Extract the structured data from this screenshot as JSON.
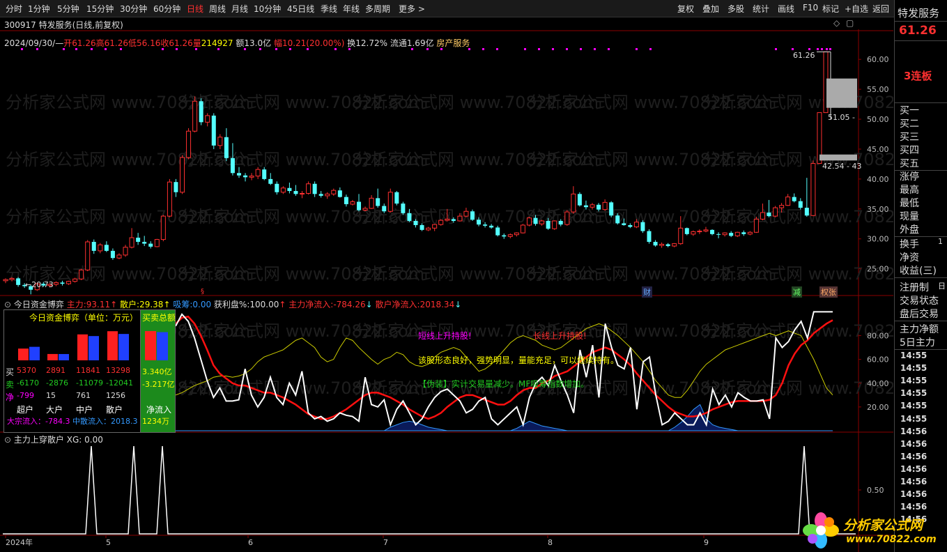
{
  "toolbar": {
    "items": [
      "分时",
      "1分钟",
      "5分钟",
      "15分钟",
      "30分钟",
      "60分钟",
      "日线",
      "周线",
      "月线",
      "10分钟",
      "45日线",
      "季线",
      "年线",
      "多周期",
      "更多 >"
    ],
    "active": "日线",
    "right_items": [
      "复权",
      "叠加",
      "多股",
      "统计",
      "画线",
      "F10",
      "标记",
      "+自选",
      "返回"
    ]
  },
  "stock": {
    "title": "300917 特发服务(日线,前复权)",
    "date": "2024/09/30/—",
    "open_label": "开",
    "open": "61.26",
    "high_label": "高",
    "high": "61.26",
    "low_label": "低",
    "low": "56.16",
    "close_label": "收",
    "close": "61.26",
    "vol_label": "量",
    "vol": "214927",
    "amount": "额13.0亿",
    "range_label": "幅",
    "range": "10.21(20.00%)",
    "turnover": "换12.72%",
    "float": "流通1.69亿",
    "sector": "房产服务"
  },
  "main_chart": {
    "y_ticks": [
      "60.00",
      "55.00",
      "50.00",
      "45.00",
      "40.00",
      "35.00",
      "30.00",
      "25.00"
    ],
    "y_tick_values": [
      60,
      55,
      50,
      45,
      40,
      35,
      30,
      25
    ],
    "ylim": [
      21,
      62
    ],
    "max_label": "61.26",
    "min_label": "←20.73",
    "bid_label_1": "51.05 -",
    "bid_label_2": "42.54 - 43",
    "marker_1": "财",
    "marker_2": "减",
    "marker_3": "权张",
    "candles": [
      [
        23.0,
        23.4,
        22.6,
        23.2
      ],
      [
        23.2,
        23.6,
        22.9,
        23.4
      ],
      [
        23.4,
        23.6,
        22.0,
        22.3
      ],
      [
        22.3,
        22.6,
        21.8,
        22.1
      ],
      [
        22.1,
        22.3,
        20.73,
        21.5
      ],
      [
        21.5,
        22.7,
        21.3,
        22.5
      ],
      [
        22.5,
        22.8,
        22.0,
        22.2
      ],
      [
        22.2,
        22.6,
        21.9,
        22.4
      ],
      [
        22.4,
        22.9,
        22.1,
        22.7
      ],
      [
        22.7,
        23.0,
        22.2,
        22.5
      ],
      [
        22.5,
        23.0,
        22.3,
        22.9
      ],
      [
        22.9,
        23.5,
        22.7,
        23.3
      ],
      [
        23.3,
        25.0,
        23.1,
        24.8
      ],
      [
        24.8,
        29.8,
        24.6,
        29.5
      ],
      [
        29.5,
        29.9,
        27.5,
        28.0
      ],
      [
        28.0,
        29.3,
        27.6,
        29.0
      ],
      [
        29.0,
        29.6,
        27.8,
        28.0
      ],
      [
        28.0,
        28.4,
        26.5,
        26.8
      ],
      [
        26.8,
        27.6,
        26.6,
        27.3
      ],
      [
        27.3,
        29.0,
        27.0,
        28.6
      ],
      [
        28.6,
        31.8,
        28.4,
        30.2
      ],
      [
        30.2,
        31.0,
        29.0,
        29.5
      ],
      [
        29.5,
        30.5,
        28.8,
        29.2
      ],
      [
        29.2,
        29.6,
        28.4,
        28.7
      ],
      [
        28.7,
        30.0,
        28.6,
        29.9
      ],
      [
        29.9,
        34.0,
        29.6,
        33.8
      ],
      [
        33.8,
        40.0,
        33.6,
        39.5
      ],
      [
        39.5,
        40.0,
        37.0,
        37.8
      ],
      [
        37.8,
        44.0,
        37.5,
        43.6
      ],
      [
        43.6,
        48.5,
        43.3,
        48.0
      ],
      [
        48.0,
        53.8,
        47.8,
        53.0
      ],
      [
        53.0,
        53.5,
        49.0,
        49.5
      ],
      [
        49.5,
        51.0,
        48.8,
        50.6
      ],
      [
        50.6,
        51.0,
        45.0,
        45.6
      ],
      [
        45.6,
        47.5,
        45.0,
        47.0
      ],
      [
        47.0,
        48.5,
        43.0,
        43.5
      ],
      [
        43.5,
        46.0,
        40.6,
        41.0
      ],
      [
        41.0,
        42.0,
        40.2,
        40.6
      ],
      [
        40.6,
        41.0,
        39.6,
        40.3
      ],
      [
        40.3,
        41.0,
        39.8,
        40.5
      ],
      [
        40.5,
        42.0,
        40.0,
        41.6
      ],
      [
        41.6,
        42.0,
        39.8,
        40.0
      ],
      [
        40.0,
        41.0,
        39.0,
        39.2
      ],
      [
        39.2,
        39.6,
        37.4,
        37.8
      ],
      [
        37.8,
        38.8,
        37.5,
        38.5
      ],
      [
        38.5,
        39.4,
        37.6,
        38.0
      ],
      [
        38.0,
        39.0,
        37.2,
        37.5
      ],
      [
        37.5,
        38.0,
        36.8,
        37.6
      ],
      [
        37.6,
        39.6,
        37.4,
        39.2
      ],
      [
        39.2,
        39.6,
        37.0,
        37.5
      ],
      [
        37.5,
        38.0,
        36.9,
        37.2
      ],
      [
        37.2,
        37.8,
        36.7,
        37.5
      ],
      [
        37.5,
        38.4,
        37.2,
        38.1
      ],
      [
        38.1,
        38.6,
        36.9,
        37.0
      ],
      [
        37.0,
        37.4,
        35.4,
        35.8
      ],
      [
        35.8,
        36.5,
        35.6,
        36.2
      ],
      [
        36.2,
        37.5,
        34.6,
        34.8
      ],
      [
        34.8,
        35.4,
        34.6,
        35.1
      ],
      [
        35.1,
        37.3,
        35.0,
        36.8
      ],
      [
        36.8,
        38.4,
        35.2,
        35.5
      ],
      [
        35.5,
        35.9,
        34.3,
        34.6
      ],
      [
        34.6,
        38.4,
        34.4,
        37.8
      ],
      [
        37.8,
        38.0,
        35.6,
        35.9
      ],
      [
        35.9,
        36.2,
        34.0,
        34.3
      ],
      [
        34.3,
        35.0,
        32.8,
        33.0
      ],
      [
        33.0,
        33.3,
        31.9,
        32.3
      ],
      [
        32.3,
        32.6,
        31.3,
        31.5
      ],
      [
        31.5,
        32.0,
        31.3,
        31.8
      ],
      [
        31.8,
        32.5,
        31.3,
        32.4
      ],
      [
        32.4,
        33.3,
        32.2,
        33.1
      ],
      [
        33.1,
        35.0,
        32.9,
        33.3
      ],
      [
        33.3,
        33.6,
        32.7,
        33.0
      ],
      [
        33.0,
        34.3,
        32.9,
        33.8
      ],
      [
        33.8,
        35.2,
        33.6,
        34.6
      ],
      [
        34.6,
        34.9,
        33.0,
        33.2
      ],
      [
        33.2,
        33.6,
        32.1,
        32.4
      ],
      [
        32.4,
        32.8,
        31.9,
        32.2
      ],
      [
        32.2,
        32.5,
        31.7,
        31.9
      ],
      [
        31.9,
        32.2,
        30.4,
        30.6
      ],
      [
        30.6,
        30.9,
        30.0,
        30.4
      ],
      [
        30.4,
        30.9,
        30.1,
        30.7
      ],
      [
        30.7,
        31.1,
        30.4,
        31.0
      ],
      [
        31.0,
        32.5,
        30.9,
        32.3
      ],
      [
        32.3,
        33.7,
        32.1,
        33.5
      ],
      [
        33.5,
        34.0,
        32.2,
        32.5
      ],
      [
        32.5,
        33.2,
        32.2,
        33.0
      ],
      [
        33.0,
        33.5,
        31.5,
        31.7
      ],
      [
        31.7,
        33.1,
        31.5,
        33.0
      ],
      [
        33.0,
        33.3,
        32.1,
        32.4
      ],
      [
        32.4,
        34.8,
        32.2,
        34.5
      ],
      [
        34.5,
        38.8,
        34.2,
        37.5
      ],
      [
        37.5,
        37.8,
        35.4,
        35.6
      ],
      [
        35.6,
        36.4,
        34.9,
        35.3
      ],
      [
        35.3,
        36.0,
        34.9,
        35.7
      ],
      [
        35.7,
        36.0,
        34.6,
        34.9
      ],
      [
        34.9,
        36.6,
        34.7,
        36.1
      ],
      [
        36.1,
        36.3,
        33.6,
        33.9
      ],
      [
        33.9,
        34.3,
        32.4,
        32.6
      ],
      [
        32.6,
        33.4,
        32.2,
        32.3
      ],
      [
        32.3,
        32.6,
        31.8,
        32.0
      ],
      [
        32.0,
        33.3,
        31.8,
        32.8
      ],
      [
        32.8,
        33.1,
        31.0,
        31.3
      ],
      [
        31.3,
        31.6,
        29.2,
        29.5
      ],
      [
        29.5,
        29.8,
        28.7,
        28.9
      ],
      [
        28.9,
        29.4,
        28.5,
        29.1
      ],
      [
        29.1,
        29.3,
        28.6,
        28.8
      ],
      [
        28.8,
        29.3,
        28.6,
        29.2
      ],
      [
        29.2,
        33.8,
        29.0,
        31.8
      ],
      [
        31.8,
        31.9,
        30.6,
        30.8
      ],
      [
        30.8,
        31.4,
        30.5,
        31.2
      ],
      [
        31.2,
        31.6,
        30.8,
        31.3
      ],
      [
        31.3,
        32.0,
        31.1,
        31.5
      ],
      [
        31.5,
        31.6,
        30.6,
        30.8
      ],
      [
        30.8,
        31.1,
        30.1,
        30.7
      ],
      [
        30.7,
        31.1,
        30.4,
        31.0
      ],
      [
        31.0,
        31.3,
        30.3,
        30.5
      ],
      [
        30.5,
        31.2,
        30.3,
        31.1
      ],
      [
        31.1,
        31.4,
        30.5,
        30.8
      ],
      [
        30.8,
        31.3,
        30.6,
        31.1
      ],
      [
        31.1,
        33.7,
        31.0,
        33.3
      ],
      [
        33.3,
        35.9,
        33.1,
        34.4
      ],
      [
        34.4,
        36.5,
        33.6,
        33.8
      ],
      [
        33.8,
        35.5,
        33.6,
        35.2
      ],
      [
        35.2,
        36.0,
        34.4,
        35.6
      ],
      [
        35.6,
        37.5,
        35.5,
        37.0
      ],
      [
        37.0,
        37.6,
        36.1,
        36.3
      ],
      [
        36.3,
        36.8,
        34.9,
        35.2
      ],
      [
        35.2,
        40.2,
        33.7,
        33.9
      ],
      [
        33.9,
        43.1,
        33.8,
        42.6
      ],
      [
        42.6,
        51.1,
        42.5,
        51.1
      ],
      [
        51.1,
        61.26,
        56.16,
        61.26
      ]
    ]
  },
  "indicator1": {
    "name": "今日资金博弈",
    "zhuli_label": "主力:",
    "zhuli_val": "93.11",
    "sanhu_label": "散户:",
    "sanhu_val": "29.38",
    "xichou_label": "吸筹:",
    "xichou_val": "0.00",
    "huoli_label": "获利盘%:",
    "huoli_val": "100.00",
    "zhuli_net_label": "主力净流入:",
    "zhuli_net_val": "-784.26",
    "sanhu_net_label": "散户净流入:",
    "sanhu_net_val": "2018.34",
    "y_ticks": [
      "80.00",
      "60.00",
      "40.00",
      "20.00"
    ],
    "y_tick_values": [
      80,
      60,
      40,
      20
    ],
    "ylim": [
      0,
      102
    ],
    "text_1": "短线上升持股!",
    "text_2": "长线上升持股!",
    "text_3": "该股形态良好，强势明显，量能充足，可以继续持有。",
    "text_4": "【伪装】实计交易量减少。MF吸筹指数增加。",
    "white": [
      88,
      98,
      92,
      78,
      60,
      42,
      28,
      36,
      25,
      25,
      26,
      52,
      30,
      20,
      28,
      45,
      28,
      22,
      40,
      30,
      50,
      15,
      10,
      12,
      8,
      10,
      15,
      13,
      12,
      8,
      45,
      22,
      20,
      26,
      5,
      18,
      25,
      15,
      5,
      10,
      20,
      28,
      33,
      35,
      30,
      25,
      15,
      18,
      25,
      28,
      10,
      5,
      10,
      15,
      20,
      5,
      28,
      40,
      45,
      38,
      55,
      42,
      30,
      15,
      68,
      45,
      72,
      28,
      90,
      70,
      55,
      52,
      70,
      18,
      58,
      62,
      30,
      5,
      8,
      15,
      10,
      5,
      5,
      15,
      5,
      35,
      22,
      30,
      20,
      32,
      28,
      25,
      25,
      26,
      10,
      78,
      70,
      75,
      85,
      92,
      78,
      100,
      100,
      100,
      100
    ],
    "red": [
      90,
      95,
      96,
      90,
      80,
      68,
      55,
      48,
      44,
      40,
      38,
      38,
      36,
      34,
      32,
      32,
      30,
      28,
      25,
      22,
      18,
      14,
      12,
      10,
      10,
      12,
      15,
      18,
      22,
      26,
      30,
      32,
      32,
      30,
      28,
      25,
      22,
      18,
      15,
      12,
      10,
      12,
      15,
      20,
      24,
      28,
      30,
      30,
      28,
      26,
      24,
      22,
      22,
      25,
      30,
      34,
      36,
      36,
      40,
      42,
      46,
      48,
      50,
      54,
      58,
      62,
      66,
      68,
      70,
      68,
      64,
      60,
      55,
      48,
      42,
      36,
      30,
      25,
      20,
      16,
      14,
      12,
      12,
      13,
      15,
      18,
      20,
      22,
      24,
      25,
      25,
      25,
      25,
      25,
      26,
      30,
      40,
      55,
      65,
      72,
      76,
      82,
      86,
      90,
      93
    ],
    "yellow": [
      30,
      32,
      35,
      38,
      40,
      42,
      45,
      46,
      46,
      45,
      46,
      48,
      52,
      58,
      62,
      64,
      66,
      68,
      72,
      76,
      78,
      74,
      70,
      62,
      58,
      60,
      70,
      78,
      76,
      70,
      65,
      60,
      56,
      60,
      62,
      66,
      64,
      58,
      55,
      54,
      56,
      62,
      66,
      68,
      70,
      68,
      62,
      56,
      50,
      52,
      56,
      62,
      68,
      74,
      78,
      80,
      78,
      76,
      72,
      70,
      68,
      70,
      74,
      78,
      82,
      86,
      88,
      90,
      88,
      84,
      80,
      75,
      70,
      64,
      58,
      50,
      42,
      36,
      30,
      28,
      28,
      34,
      42,
      50,
      56,
      60,
      64,
      68,
      70,
      72,
      74,
      76,
      78,
      80,
      82,
      80,
      82,
      84,
      82,
      80,
      70,
      60,
      48,
      36,
      30
    ],
    "blue": [
      0,
      0,
      0,
      0,
      0,
      0,
      0,
      0,
      0,
      0,
      0,
      0,
      0,
      0,
      0,
      0,
      0,
      0,
      0,
      0,
      0,
      0,
      0,
      0,
      0,
      0,
      0,
      0,
      0,
      0,
      0,
      0,
      0,
      0,
      3,
      5,
      7,
      8,
      7,
      5,
      3,
      2,
      1,
      0,
      0,
      0,
      0,
      0,
      0,
      0,
      0,
      0,
      0,
      0,
      2,
      5,
      8,
      6,
      4,
      3,
      2,
      1,
      0,
      0,
      0,
      0,
      0,
      0,
      0,
      0,
      0,
      0,
      0,
      0,
      0,
      0,
      0,
      0,
      0,
      3,
      7,
      12,
      18,
      22,
      10,
      5,
      3,
      2,
      1,
      0,
      0,
      0,
      0,
      0,
      0,
      0,
      0,
      0,
      0,
      0,
      0,
      0,
      0,
      0,
      0
    ]
  },
  "fund_box": {
    "title": "今日资金博弈（单位：万元）",
    "right_title": "买卖总额",
    "row_labels": [
      "买",
      "卖",
      "净"
    ],
    "buy": [
      "5370",
      "2891",
      "11841",
      "13298"
    ],
    "sell": [
      "-6170",
      "-2876",
      "-11079",
      "-12041"
    ],
    "net": [
      "-799",
      "15",
      "761",
      "1256"
    ],
    "cols": [
      "超户",
      "大户",
      "中户",
      "散户"
    ],
    "total_buy": "3.340亿",
    "total_sell": "-3.217亿",
    "net_label": "净流入",
    "net_total": "1234万",
    "dazong": "大宗流入：-784.3",
    "zhongsan": "中散流入：2018.3",
    "bars_buy": [
      5370,
      2891,
      11841,
      13298
    ],
    "bars_sell": [
      6170,
      2876,
      11079,
      12041
    ],
    "total_buy_val": 3.34,
    "total_sell_val": 3.217
  },
  "indicator2": {
    "name": "主力上穿散户",
    "xg_label": "XG:",
    "xg_val": "0.00",
    "y_tick": "0.50",
    "spikes": [
      30,
      42,
      50,
      249
    ]
  },
  "x_axis": {
    "labels": [
      "2024年",
      "5",
      "6",
      "7",
      "8",
      "9"
    ],
    "positions": [
      0,
      29,
      69,
      108,
      155,
      199
    ]
  },
  "sidepanel": {
    "name": "特发服务",
    "price": "61.26",
    "streak": "3连板",
    "levels": [
      "买一",
      "买二",
      "买三",
      "买四",
      "买五"
    ],
    "stats": [
      "涨停",
      "最高",
      "最低",
      "现量",
      "外盘"
    ],
    "stats2": [
      "换手",
      "净资",
      "收益(三)"
    ],
    "other": [
      "注册制",
      "交易状态",
      "盘后交易"
    ],
    "fund": [
      "主力净额",
      "5日主力"
    ],
    "times": [
      "14:55",
      "14:55",
      "14:55",
      "14:55",
      "14:55",
      "14:55",
      "14:56",
      "14:56",
      "14:56",
      "14:56",
      "14:56",
      "14:56",
      "14:56",
      "14:56"
    ],
    "misc": [
      "1",
      "日"
    ]
  },
  "watermark": "分析家公式网 www.70822.com",
  "logo": {
    "cn": "分析家公式网",
    "url": "www.70822.com"
  },
  "colors": {
    "up": "#ff3030",
    "down": "#54ffff",
    "yellow": "#ffff00",
    "magenta": "#ff00ff",
    "blue": "#3399ff",
    "green": "#22cc22"
  }
}
